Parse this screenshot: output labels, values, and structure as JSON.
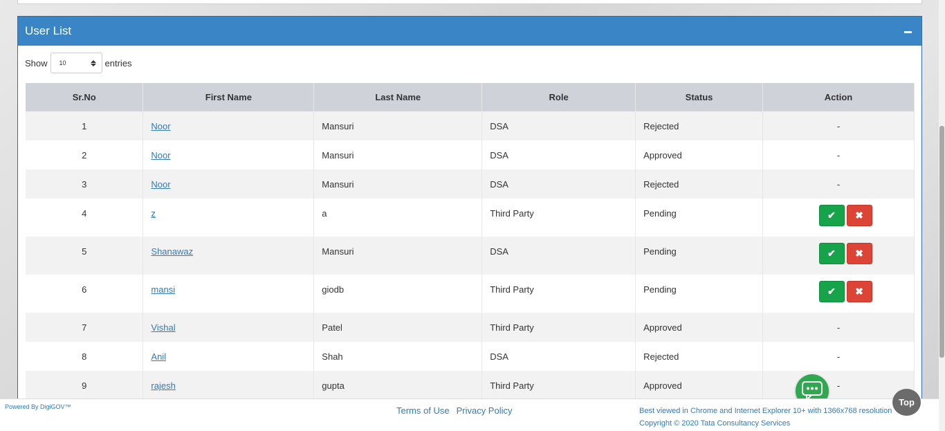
{
  "panel": {
    "title": "User List"
  },
  "length": {
    "show_label": "Show",
    "value": "10",
    "entries_label": "entries"
  },
  "table": {
    "headers": [
      "Sr.No",
      "First Name",
      "Last Name",
      "Role",
      "Status",
      "Action"
    ],
    "rows": [
      {
        "sr": "1",
        "first": "Noor",
        "last": "Mansuri",
        "role": "DSA",
        "status": "Rejected",
        "action": "-"
      },
      {
        "sr": "2",
        "first": "Noor",
        "last": "Mansuri",
        "role": "DSA",
        "status": "Approved",
        "action": "-"
      },
      {
        "sr": "3",
        "first": "Noor",
        "last": "Mansuri",
        "role": "DSA",
        "status": "Rejected",
        "action": "-"
      },
      {
        "sr": "4",
        "first": "z",
        "last": "a",
        "role": "Third Party",
        "status": "Pending",
        "action": "buttons"
      },
      {
        "sr": "5",
        "first": "Shanawaz",
        "last": "Mansuri",
        "role": "DSA",
        "status": "Pending",
        "action": "buttons"
      },
      {
        "sr": "6",
        "first": "mansi",
        "last": "giodb",
        "role": "Third Party",
        "status": "Pending",
        "action": "buttons"
      },
      {
        "sr": "7",
        "first": "Vishal",
        "last": "Patel",
        "role": "Third Party",
        "status": "Approved",
        "action": "-"
      },
      {
        "sr": "8",
        "first": "Anil",
        "last": "Shah",
        "role": "DSA",
        "status": "Rejected",
        "action": "-"
      },
      {
        "sr": "9",
        "first": "rajesh",
        "last": "gupta",
        "role": "Third Party",
        "status": "Approved",
        "action": "-"
      }
    ]
  },
  "footer": {
    "powered": "Powered By DigiGOV™",
    "terms": "Terms of Use",
    "privacy": "Privacy Policy",
    "best_viewed": "Best viewed in Chrome and Internet Explorer 10+ with 1366x768 resolution",
    "copyright": "Copyright © 2020 Tata Consultancy Services"
  },
  "top_button": "Top",
  "icons": {
    "approve": "check-icon",
    "reject": "times-icon",
    "chat": "chat-icon",
    "collapse": "minus-icon"
  },
  "colors": {
    "header": "#3a85c6",
    "approve": "#16a34a",
    "reject": "#dc4535",
    "link": "#337ab7",
    "chat": "#2fa84f"
  }
}
